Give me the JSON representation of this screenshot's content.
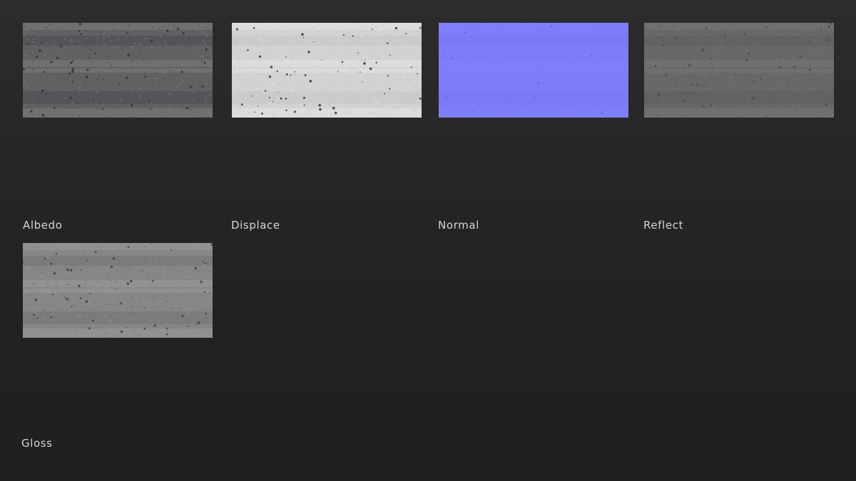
{
  "maps": [
    {
      "label": "Albedo",
      "icon": "albedo-map-thumbnail",
      "base": "#5f6163",
      "band": "#7c7e80",
      "dark": "#4b4d50",
      "speck": "#2e3033"
    },
    {
      "label": "Displace",
      "icon": "displace-map-thumbnail",
      "base": "#d2d2d2",
      "band": "#e3e3e3",
      "dark": "#c4c4c4",
      "speck": "#2a2a2a"
    },
    {
      "label": "Normal",
      "icon": "normal-map-thumbnail",
      "base": "#7d7df8",
      "band": "#8282fb",
      "dark": "#7878f2",
      "speck": "#6a6ae0"
    },
    {
      "label": "Reflect",
      "icon": "reflect-map-thumbnail",
      "base": "#686868",
      "band": "#767676",
      "dark": "#5c5c5c",
      "speck": "#4a4a4a"
    },
    {
      "label": "Gloss",
      "icon": "gloss-map-thumbnail",
      "base": "#868686",
      "band": "#9a9a9a",
      "dark": "#737373",
      "speck": "#3e3e3e"
    }
  ]
}
